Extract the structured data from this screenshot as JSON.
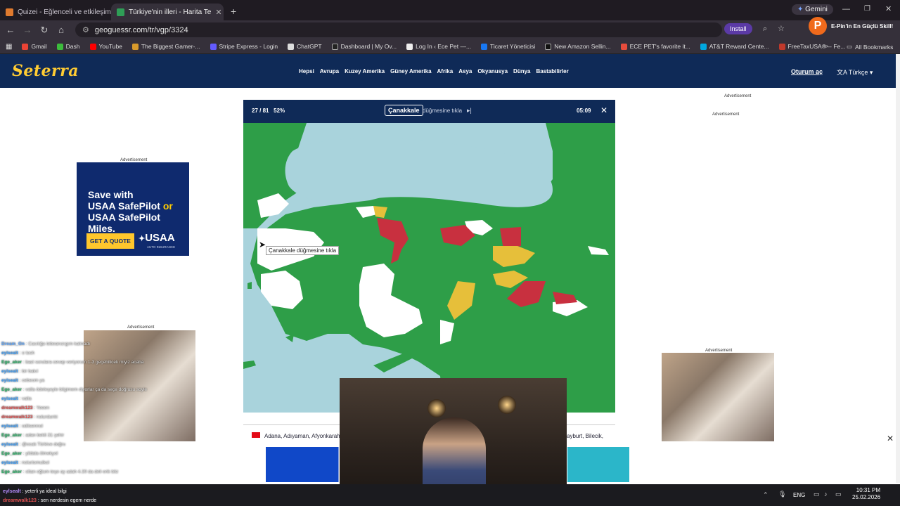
{
  "browser": {
    "tabs": [
      {
        "label": "Quizei - Eğlenceli ve etkileşimli",
        "active": false
      },
      {
        "label": "Türkiye'nin illeri - Harita Te",
        "active": true
      }
    ],
    "url": "geoguessr.com/tr/vgp/3324",
    "install_label": "Install",
    "gemini_label": "Gemini",
    "ext_label": "E-Pin'in En Güçlü Skill!",
    "bookmarks": [
      "Gmail",
      "Dash",
      "YouTube",
      "The Biggest Gamer-...",
      "Stripe Express - Login",
      "ChatGPT",
      "Dashboard | My Ov...",
      "Log In ‹ Ece Pet —...",
      "Ticaret Yöneticisi",
      "New Amazon Sellin...",
      "ECE PET's favorite it...",
      "AT&T Reward Cente...",
      "FreeTaxUSA® -- Fe..."
    ],
    "all_bookmarks": "All Bookmarks"
  },
  "site": {
    "logo": "Seterra",
    "nav": [
      "Hepsi",
      "Avrupa",
      "Kuzey Amerika",
      "Güney Amerika",
      "Afrika",
      "Asya",
      "Okyanusya",
      "Dünya",
      "Bastabilirler"
    ],
    "login": "Oturum aç",
    "language": "Türkçe"
  },
  "game": {
    "counter": "27 / 81",
    "percent": "52%",
    "target": "Çanakkale",
    "prompt": "düğmesine tıkla",
    "timer": "05:09",
    "tooltip": "Çanakkale düğmesine tıkla",
    "list_left": "Adana, Adıyaman, Afyonkarahis",
    "list_right": "ayburt, Bilecik,"
  },
  "ads": {
    "label": "Advertisement",
    "usaa_line1": "Save with",
    "usaa_line2": "USAA SafePilot",
    "usaa_line3": "or",
    "usaa_line4": "USAA SafePilot Miles.",
    "usaa_cta": "GET A QUOTE",
    "usaa_brand": "USAA",
    "usaa_sub": "AUTO INSURANCE"
  },
  "chat": [
    {
      "user": "Dream_On",
      "msg": "Cacılığa tebeanızıgım kalmadı"
    },
    {
      "user": "eylsealt",
      "msg": "o tosh"
    },
    {
      "user": "Ege_aker",
      "msg": "bazi sorulara cevap veriyorum 1-3 geçebilicek miyiz acaba"
    },
    {
      "user": "eylsealt",
      "msg": "bir bakıl"
    },
    {
      "user": "eylsealt",
      "msg": "cebeom ya"
    },
    {
      "user": "Ege_aker",
      "msg": "valla ödeleşeyle bilgimem diyorlar ça da seçe doğrusu soyle"
    },
    {
      "user": "eylsealt",
      "msg": "valla"
    },
    {
      "user": "dreamwalk123",
      "msg": "Yeeen"
    },
    {
      "user": "dreamwalk123",
      "msg": "nolurdunki"
    },
    {
      "user": "eylsealt",
      "msg": "oditsennol"
    },
    {
      "user": "Ege_aker",
      "msg": "adan bekli 31 şehir"
    },
    {
      "user": "eylsealt",
      "msg": "@ocak Türkive doğru"
    },
    {
      "user": "Ege_aker",
      "msg": "yildala ölmekyol"
    },
    {
      "user": "eylsealt",
      "msg": "nolurtomulkol"
    },
    {
      "user": "Ege_aker",
      "msg": "oltan oğlum teşe ay adah 4.30 da deli erik bliz"
    },
    {
      "user": "eylsealt",
      "msg": "yeterli ya ideal bilgi"
    },
    {
      "user": "dreamwalk123",
      "msg": "sen nerdesin egem nerde"
    }
  ],
  "taskbar": {
    "lang": "ENG",
    "time": "10:31 PM",
    "date": "25.02.2026"
  },
  "colors": {
    "header_bg": "#0f2a57",
    "sea": "#a9d3dc",
    "correct": "#2e9e48",
    "wrong": "#c8303f",
    "partial": "#e6bf3a",
    "unanswered": "#ffffff",
    "logo": "#ffcc33"
  }
}
